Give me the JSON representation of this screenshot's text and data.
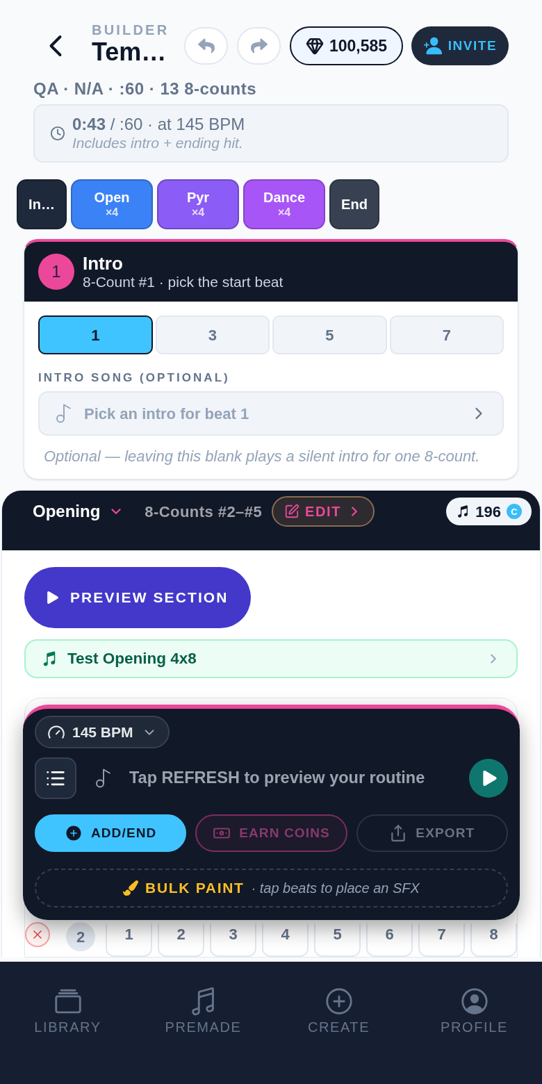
{
  "header": {
    "eyebrow": "BUILDER",
    "title": "Tem…",
    "gems": "100,585",
    "invite": "INVITE"
  },
  "meta": "QA · N/A · :60 · 13 8-counts",
  "duration": {
    "summary": "**0:43** / :60 · at 145 BPM",
    "note": "Includes intro + ending hit."
  },
  "sections": [
    {
      "label": "In…",
      "color": "#1e293b"
    },
    {
      "label": "Open",
      "count": "×4",
      "color": "#3b82f6"
    },
    {
      "label": "Pyr",
      "count": "×4",
      "color": "#8b5cf6"
    },
    {
      "label": "Dance",
      "count": "×4",
      "color": "#a855f7"
    },
    {
      "label": "End",
      "color": "#374151"
    }
  ],
  "intro_card": {
    "number": "1",
    "title": "Intro",
    "subtitle": "8-Count #1 · pick the start beat",
    "beats": [
      {
        "label": "1",
        "selected": true
      },
      {
        "label": "3",
        "selected": false
      },
      {
        "label": "5",
        "selected": false
      },
      {
        "label": "7",
        "selected": false
      }
    ],
    "song_label": "INTRO SONG (OPTIONAL)",
    "song_picker": {
      "placeholder": "Pick an intro for beat 1"
    },
    "note": "Optional — leaving this blank plays a silent intro for one 8-count."
  },
  "opening": {
    "title": "Opening",
    "range": "8-Counts #2–#5",
    "edit": "EDIT",
    "coins": "196",
    "coin_symbol": "C",
    "preview": "PREVIEW SECTION",
    "song": "Test Opening 4x8"
  },
  "beat_row": {
    "count": "2",
    "beats": [
      "1",
      "2",
      "3",
      "4",
      "5",
      "6",
      "7",
      "8"
    ]
  },
  "player": {
    "bpm": "145 BPM",
    "message": "Tap REFRESH to preview your routine",
    "actions": [
      {
        "label": "ADD/END",
        "kind": "add"
      },
      {
        "label": "EARN COINS",
        "kind": "earn"
      },
      {
        "label": "EXPORT",
        "kind": "export"
      }
    ],
    "bulk_paint": {
      "label": "BULK PAINT",
      "hint": "· tap beats to place an SFX"
    }
  },
  "nav": [
    {
      "label": "LIBRARY",
      "kind": "library"
    },
    {
      "label": "PREMADE",
      "kind": "premade"
    },
    {
      "label": "CREATE",
      "kind": "create"
    },
    {
      "label": "PROFILE",
      "kind": "profile"
    }
  ]
}
